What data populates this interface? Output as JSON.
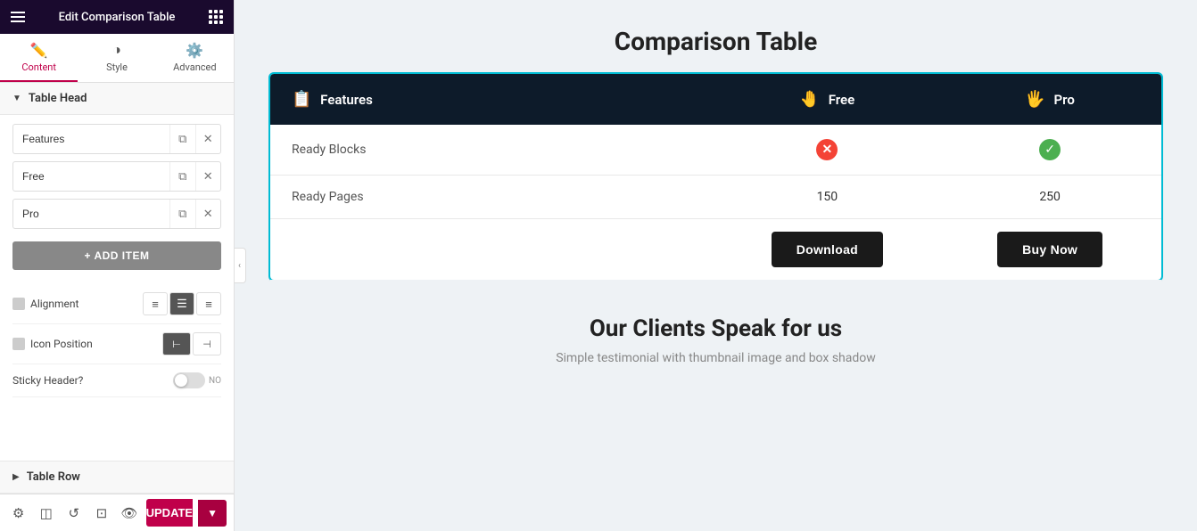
{
  "panel": {
    "topbar": {
      "title": "Edit Comparison Table",
      "hamburger_label": "menu",
      "grid_label": "grid-options"
    },
    "tabs": [
      {
        "id": "content",
        "label": "Content",
        "icon": "✏️",
        "active": true
      },
      {
        "id": "style",
        "label": "Style",
        "icon": "◑",
        "active": false
      },
      {
        "id": "advanced",
        "label": "Advanced",
        "icon": "⚙️",
        "active": false
      }
    ],
    "table_head": {
      "label": "Table Head",
      "items": [
        {
          "value": "Features",
          "id": "item-features"
        },
        {
          "value": "Free",
          "id": "item-free"
        },
        {
          "value": "Pro",
          "id": "item-pro"
        }
      ],
      "add_item_label": "+ ADD ITEM"
    },
    "settings": {
      "alignment": {
        "label": "Alignment",
        "options": [
          "left",
          "center",
          "right"
        ],
        "active": "center"
      },
      "icon_position": {
        "label": "Icon Position",
        "options": [
          "left",
          "right"
        ],
        "active": "left"
      },
      "sticky_header": {
        "label": "Sticky Header?",
        "value": false,
        "no_label": "NO"
      }
    },
    "table_row": {
      "label": "Table Row"
    },
    "bottom_bar": {
      "update_label": "UPDATE",
      "icons": [
        "gear",
        "layers",
        "history",
        "responsive",
        "eye"
      ]
    }
  },
  "main": {
    "title": "Comparison Table",
    "table": {
      "head": {
        "features_col": "Features",
        "free_col": "Free",
        "pro_col": "Pro",
        "features_icon": "📋",
        "free_icon": "🤚",
        "pro_icon": "🖐"
      },
      "rows": [
        {
          "feature": "Ready Blocks",
          "free_value": "cross",
          "pro_value": "check"
        },
        {
          "feature": "Ready Pages",
          "free_value": "150",
          "pro_value": "250"
        }
      ],
      "buttons_row": {
        "download_label": "Download",
        "buynow_label": "Buy Now"
      }
    },
    "bottom_section": {
      "title": "Our Clients Speak for us",
      "subtitle": "Simple testimonial with thumbnail image and box shadow"
    }
  }
}
